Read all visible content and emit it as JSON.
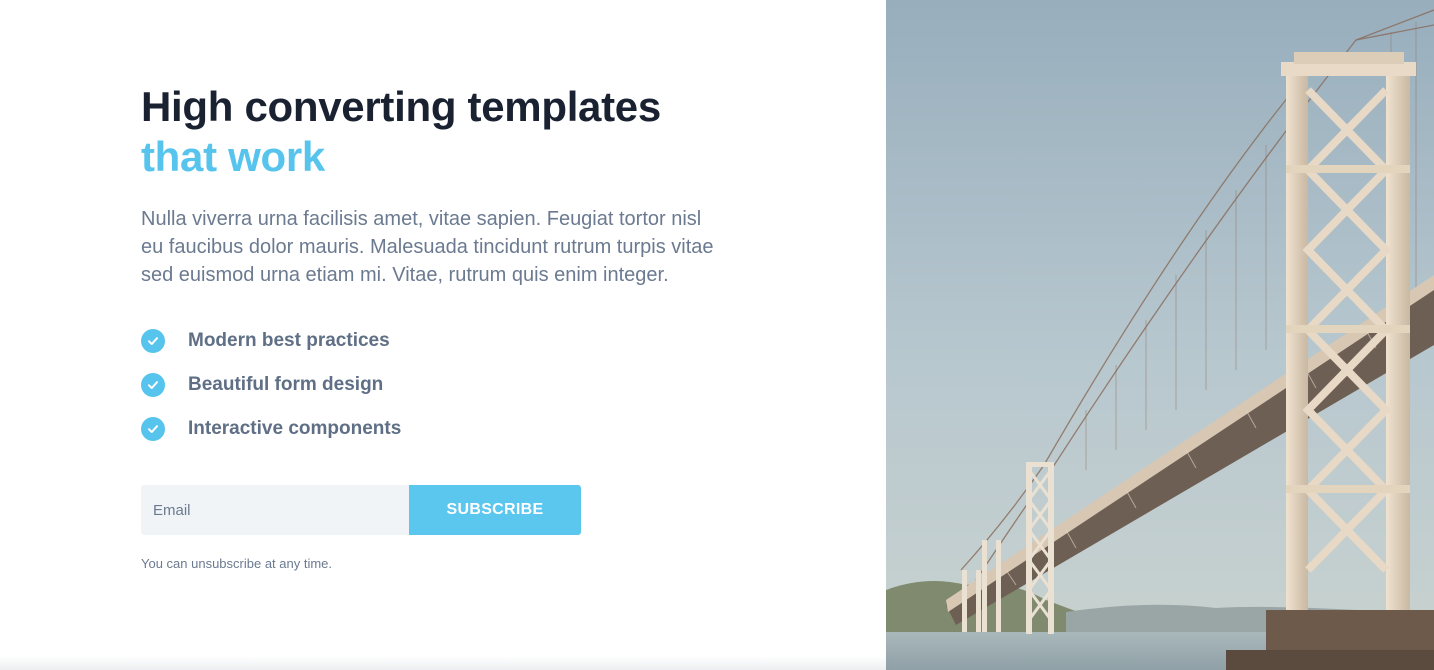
{
  "hero": {
    "title_line1": "High converting templates",
    "title_line2": "that work",
    "description": "Nulla viverra urna facilisis amet, vitae sapien. Feugiat tortor nisl eu faucibus dolor mauris. Malesuada tincidunt rutrum turpis vitae sed euismod urna etiam mi. Vitae, rutrum quis enim integer."
  },
  "features": [
    {
      "label": "Modern best practices",
      "icon": "check-circle-icon"
    },
    {
      "label": "Beautiful form design",
      "icon": "check-circle-icon"
    },
    {
      "label": "Interactive components",
      "icon": "check-circle-icon"
    }
  ],
  "form": {
    "email_placeholder": "Email",
    "email_value": "",
    "subscribe_label": "SUBSCRIBE",
    "disclaimer": "You can unsubscribe at any time."
  },
  "colors": {
    "accent": "#56c4ec",
    "heading": "#1a2232",
    "body_text": "#6b7a90",
    "input_background": "#f1f4f7"
  },
  "image": {
    "subject": "bridge-photo"
  }
}
